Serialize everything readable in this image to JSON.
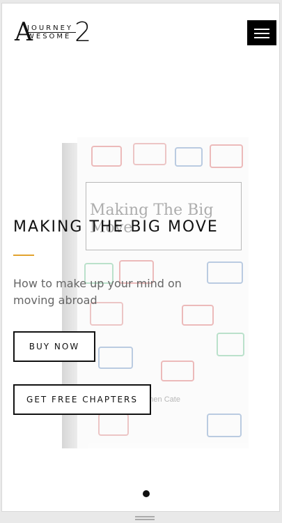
{
  "header": {
    "logo": {
      "big_letter": "A",
      "line1": "JOURNEY",
      "line2": "WESOME",
      "number": "2"
    },
    "menu_icon": "hamburger-icon"
  },
  "hero": {
    "title": "MAKING THE BIG MOVE",
    "subtitle": "How to make up your mind on moving abroad",
    "buy_button": "BUY NOW",
    "chapters_button": "GET FREE CHAPTERS"
  },
  "book": {
    "cover_title": "Making The Big Move",
    "author": "by Stephen Cate"
  },
  "carousel": {
    "dots": 1,
    "active": 1
  },
  "colors": {
    "accent": "#e2a32e",
    "button_border": "#111111",
    "menu_background": "#000000",
    "subtitle_text": "#666666"
  }
}
